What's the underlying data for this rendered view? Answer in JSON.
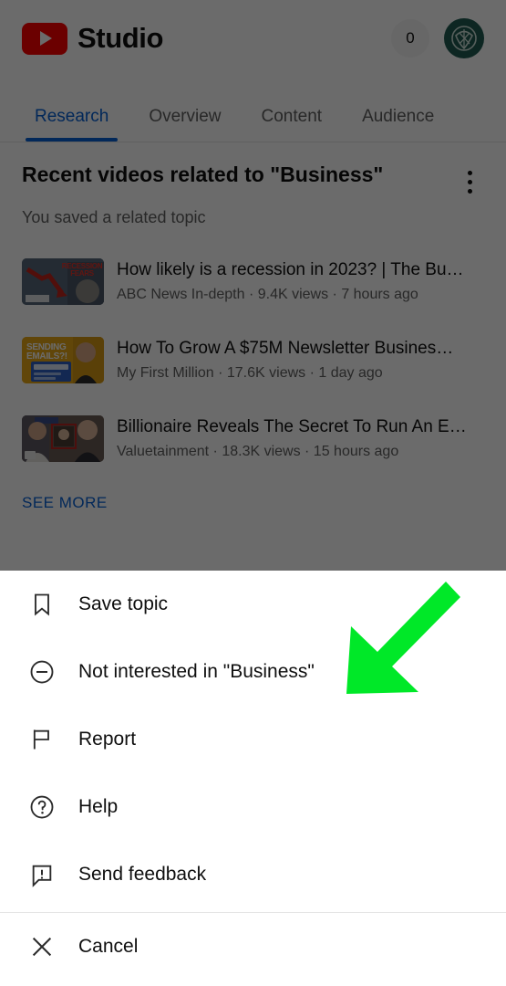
{
  "header": {
    "brand_name": "Studio",
    "logo_icon": "youtube-play-icon",
    "notification_count": "0",
    "avatar_icon": "channel-avatar"
  },
  "tabs": [
    {
      "label": "Research",
      "active": true
    },
    {
      "label": "Overview",
      "active": false
    },
    {
      "label": "Content",
      "active": false
    },
    {
      "label": "Audience",
      "active": false
    }
  ],
  "research": {
    "section_title": "Recent videos related to \"Business\"",
    "section_subtitle": "You saved a related topic",
    "overflow_icon": "more-vertical-icon",
    "see_more_label": "SEE MORE",
    "videos": [
      {
        "title": "How likely is a recession in 2023? | The Bu…",
        "channel": "ABC News In-depth",
        "views": "9.4K views",
        "age": "7 hours ago",
        "meta": "ABC News In-depth · 9.4K views · 7 hours ago",
        "thumbnail_text": "RECESSION FEARS"
      },
      {
        "title": "How To Grow A $75M Newsletter Busines…",
        "channel": "My First Million",
        "views": "17.6K views",
        "age": "1 day ago",
        "meta": "My First Million · 17.6K views · 1 day ago",
        "thumbnail_text": "SENDING EMAILS?!"
      },
      {
        "title": "Billionaire Reveals The Secret To Run An E…",
        "channel": "Valuetainment",
        "views": "18.3K views",
        "age": "15 hours ago",
        "meta": "Valuetainment · 18.3K views · 15 hours ago",
        "thumbnail_text": ""
      }
    ]
  },
  "bottom_sheet": {
    "items": [
      {
        "label": "Save topic",
        "icon": "bookmark-icon"
      },
      {
        "label": "Not interested in \"Business\"",
        "icon": "minus-circle-icon"
      },
      {
        "label": "Report",
        "icon": "flag-icon"
      },
      {
        "label": "Help",
        "icon": "question-circle-icon"
      },
      {
        "label": "Send feedback",
        "icon": "feedback-icon"
      }
    ],
    "cancel": {
      "label": "Cancel",
      "icon": "close-icon"
    }
  },
  "annotation": {
    "arrow_color": "#00e828",
    "points_to": "Not interested in \"Business\""
  },
  "colors": {
    "accent_blue": "#065fd4",
    "brand_red": "#ff0000",
    "text_primary": "#0f0f0f",
    "text_secondary": "#606060",
    "avatar_teal": "#1f5c52",
    "scrim": "rgba(0,0,0,0.58)"
  }
}
